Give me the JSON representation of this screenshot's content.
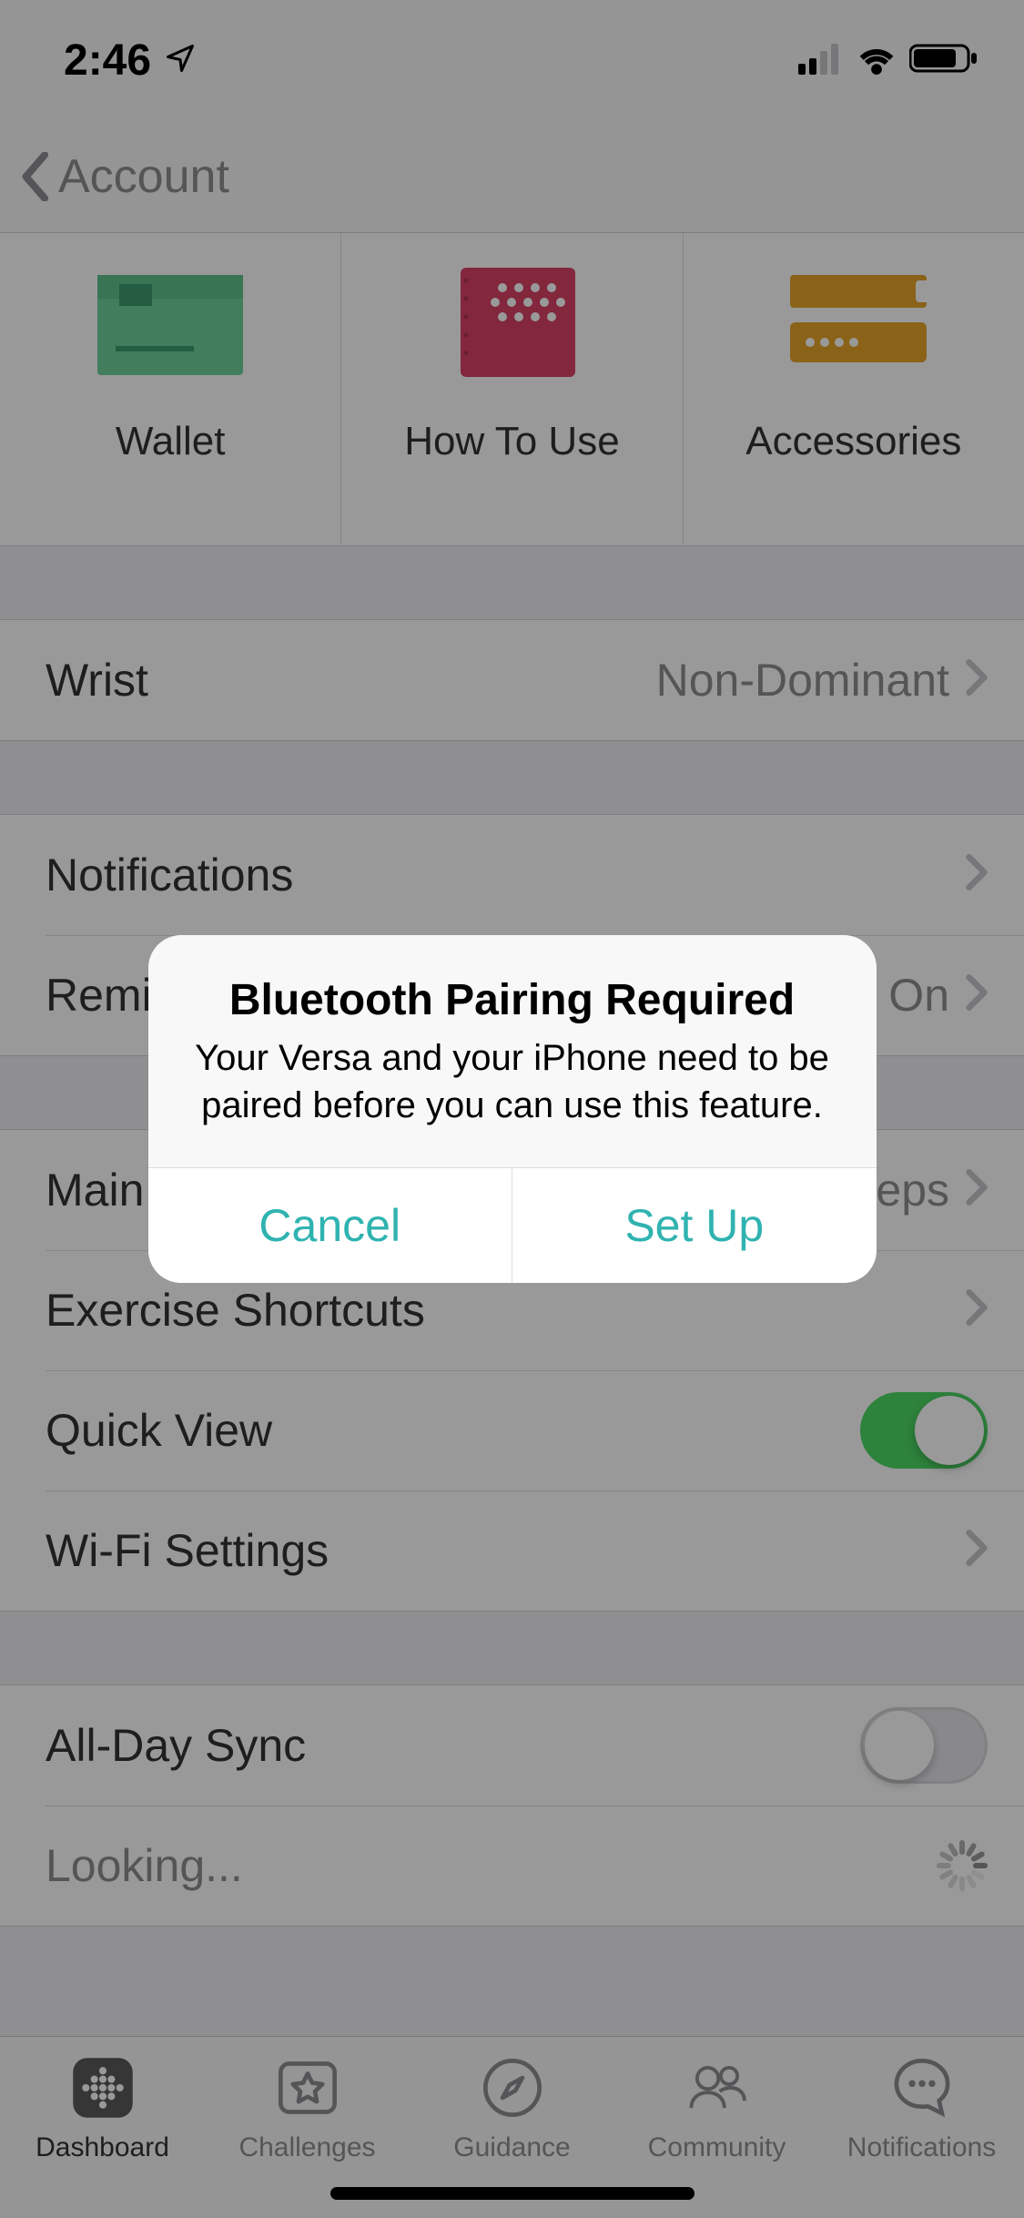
{
  "status": {
    "time": "2:46"
  },
  "nav": {
    "title": "Account"
  },
  "tiles": [
    {
      "label": "Wallet"
    },
    {
      "label": "How To Use"
    },
    {
      "label": "Accessories"
    }
  ],
  "rows": {
    "wrist": {
      "label": "Wrist",
      "value": "Non-Dominant"
    },
    "notifications": {
      "label": "Notifications"
    },
    "reminders": {
      "label": "Reminders to Move",
      "value": "On"
    },
    "mainGoal": {
      "label": "Main Goal",
      "value": "Steps"
    },
    "exercise": {
      "label": "Exercise Shortcuts"
    },
    "quickView": {
      "label": "Quick View",
      "on": true
    },
    "wifi": {
      "label": "Wi-Fi Settings"
    },
    "allDaySync": {
      "label": "All-Day Sync",
      "on": false
    },
    "looking": {
      "label": "Looking..."
    }
  },
  "tabs": [
    {
      "label": "Dashboard"
    },
    {
      "label": "Challenges"
    },
    {
      "label": "Guidance"
    },
    {
      "label": "Community"
    },
    {
      "label": "Notifications"
    }
  ],
  "alert": {
    "title": "Bluetooth Pairing Required",
    "message": "Your Versa and your iPhone need to be paired before you can use this feature.",
    "cancel": "Cancel",
    "confirm": "Set Up"
  }
}
